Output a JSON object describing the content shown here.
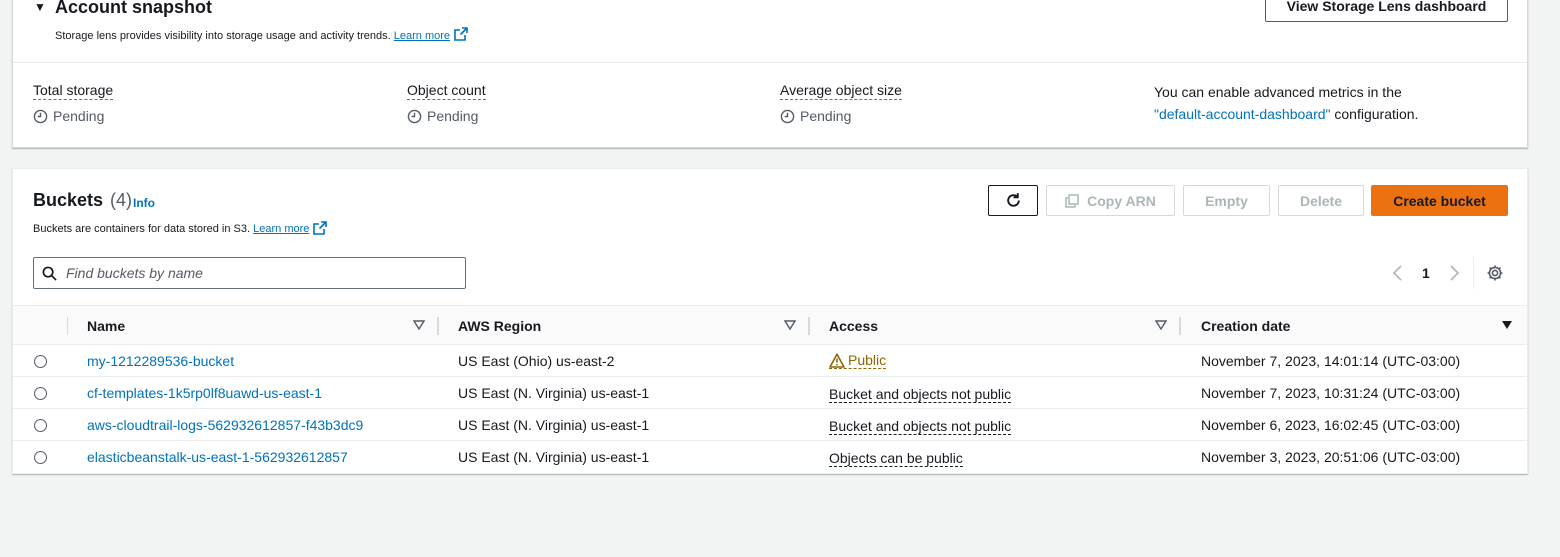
{
  "snapshot": {
    "title": "Account snapshot",
    "description": "Storage lens provides visibility into storage usage and activity trends.",
    "learn_more": "Learn more",
    "dashboard_button": "View Storage Lens dashboard",
    "metrics": [
      {
        "label": "Total storage",
        "value": "Pending"
      },
      {
        "label": "Object count",
        "value": "Pending"
      },
      {
        "label": "Average object size",
        "value": "Pending"
      }
    ],
    "advanced_note_prefix": "You can enable advanced metrics in the",
    "advanced_note_link": "\"default-account-dashboard\"",
    "advanced_note_suffix": "configuration."
  },
  "buckets": {
    "title": "Buckets",
    "count": "(4)",
    "info": "Info",
    "description": "Buckets are containers for data stored in S3.",
    "learn_more": "Learn more",
    "actions": {
      "copy_arn": "Copy ARN",
      "empty": "Empty",
      "delete": "Delete",
      "create": "Create bucket"
    },
    "search_placeholder": "Find buckets by name",
    "page": "1",
    "columns": [
      "Name",
      "AWS Region",
      "Access",
      "Creation date"
    ],
    "rows": [
      {
        "name": "my-1212289536-bucket",
        "region": "US East (Ohio) us-east-2",
        "access": "Public",
        "created": "November 7, 2023, 14:01:14 (UTC-03:00)"
      },
      {
        "name": "cf-templates-1k5rp0lf8uawd-us-east-1",
        "region": "US East (N. Virginia) us-east-1",
        "access": "Bucket and objects not public",
        "created": "November 7, 2023, 10:31:24 (UTC-03:00)"
      },
      {
        "name": "aws-cloudtrail-logs-562932612857-f43b3dc9",
        "region": "US East (N. Virginia) us-east-1",
        "access": "Bucket and objects not public",
        "created": "November 6, 2023, 16:02:45 (UTC-03:00)"
      },
      {
        "name": "elasticbeanstalk-us-east-1-562932612857",
        "region": "US East (N. Virginia) us-east-1",
        "access": "Objects can be public",
        "created": "November 3, 2023, 20:51:06 (UTC-03:00)"
      }
    ]
  },
  "colors": {
    "primary_button": "#ec7211",
    "link": "#0073bb",
    "warning": "#8d6605"
  },
  "icons": [
    "caret-down-icon",
    "external-link-icon",
    "clock-icon",
    "refresh-icon",
    "copy-icon",
    "search-icon",
    "chevron-left-icon",
    "chevron-right-icon",
    "gear-icon",
    "sort-icon",
    "warning-icon"
  ]
}
